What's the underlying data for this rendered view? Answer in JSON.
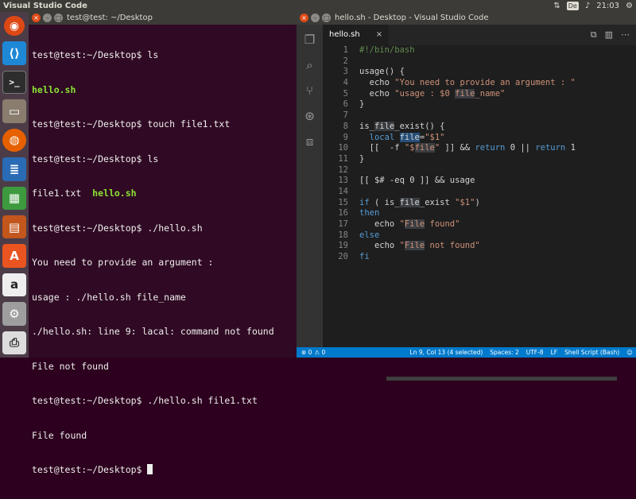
{
  "top_panel": {
    "app_title": "Visual Studio Code",
    "keyboard_indicator": "De",
    "clock": "21:03"
  },
  "launcher": {
    "items": [
      {
        "name": "Ubuntu dash",
        "glyph": "◉"
      },
      {
        "name": "Visual Studio Code",
        "glyph": "⟨⟩"
      },
      {
        "name": "Terminal",
        "glyph": ">_"
      },
      {
        "name": "Files",
        "glyph": "▭"
      },
      {
        "name": "Firefox",
        "glyph": "◍"
      },
      {
        "name": "LibreOffice Writer",
        "glyph": "≣"
      },
      {
        "name": "LibreOffice Calc",
        "glyph": "▦"
      },
      {
        "name": "LibreOffice Impress",
        "glyph": "▤"
      },
      {
        "name": "Ubuntu Software",
        "glyph": "A"
      },
      {
        "name": "Amazon",
        "glyph": "a"
      },
      {
        "name": "System Settings",
        "glyph": "⚙"
      },
      {
        "name": "Printers",
        "glyph": "⎙"
      }
    ]
  },
  "terminal": {
    "title": "test@test: ~/Desktop",
    "lines": [
      {
        "text": "test@test:~/Desktop$ ls",
        "style": "normal"
      },
      {
        "text": "hello.sh",
        "style": "green"
      },
      {
        "text": "test@test:~/Desktop$ touch file1.txt",
        "style": "normal"
      },
      {
        "text": "test@test:~/Desktop$ ls",
        "style": "normal"
      },
      {
        "text": "file1.txt  ",
        "extra": "hello.sh",
        "style": "mixed"
      },
      {
        "text": "test@test:~/Desktop$ ./hello.sh",
        "style": "normal"
      },
      {
        "text": "You need to provide an argument :",
        "style": "normal"
      },
      {
        "text": "usage : ./hello.sh file_name",
        "style": "normal"
      },
      {
        "text": "./hello.sh: line 9: lacal: command not found",
        "style": "normal"
      },
      {
        "text": "File not found",
        "style": "normal"
      },
      {
        "text": "test@test:~/Desktop$ ./hello.sh file1.txt",
        "style": "normal"
      },
      {
        "text": "File found",
        "style": "normal"
      },
      {
        "text": "test@test:~/Desktop$ ",
        "style": "prompt"
      }
    ]
  },
  "vscode": {
    "title": "hello.sh - Desktop - Visual Studio Code",
    "activity_icons": [
      "files-icon",
      "search-icon",
      "git-icon",
      "debug-icon",
      "extensions-icon"
    ],
    "tab": {
      "label": "hello.sh",
      "close": "×"
    },
    "tab_actions": [
      "⧉",
      "▥",
      "⋯"
    ],
    "code_lines": [
      [
        {
          "t": "#!/bin/bash",
          "c": "cmt"
        }
      ],
      [],
      [
        {
          "t": "usage() {",
          "c": ""
        }
      ],
      [
        {
          "t": "  echo ",
          "c": ""
        },
        {
          "t": "\"You need to provide an argument : \"",
          "c": "str"
        }
      ],
      [
        {
          "t": "  echo ",
          "c": ""
        },
        {
          "t": "\"usage : $0 ",
          "c": "str"
        },
        {
          "t": "file",
          "c": "str hl"
        },
        {
          "t": "_name\"",
          "c": "str"
        }
      ],
      [
        {
          "t": "}",
          "c": ""
        }
      ],
      [],
      [
        {
          "t": "is_",
          "c": ""
        },
        {
          "t": "file",
          "c": "hl"
        },
        {
          "t": "_exist() {",
          "c": ""
        }
      ],
      [
        {
          "t": "  ",
          "c": ""
        },
        {
          "t": "local",
          "c": "kw"
        },
        {
          "t": " ",
          "c": ""
        },
        {
          "t": "file",
          "c": "sel"
        },
        {
          "t": "=",
          "c": ""
        },
        {
          "t": "\"$1\"",
          "c": "str"
        }
      ],
      [
        {
          "t": "  [[  -f ",
          "c": ""
        },
        {
          "t": "\"$",
          "c": "str"
        },
        {
          "t": "file",
          "c": "str hl"
        },
        {
          "t": "\"",
          "c": "str"
        },
        {
          "t": " ]] && ",
          "c": ""
        },
        {
          "t": "return",
          "c": "kw"
        },
        {
          "t": " 0 || ",
          "c": ""
        },
        {
          "t": "return",
          "c": "kw"
        },
        {
          "t": " 1",
          "c": ""
        }
      ],
      [
        {
          "t": "}",
          "c": ""
        }
      ],
      [],
      [
        {
          "t": "[[ $# -eq 0 ]] && usage",
          "c": ""
        }
      ],
      [],
      [
        {
          "t": "if",
          "c": "kw"
        },
        {
          "t": " ( is_",
          "c": ""
        },
        {
          "t": "file",
          "c": "hl"
        },
        {
          "t": "_exist ",
          "c": ""
        },
        {
          "t": "\"$1\"",
          "c": "str"
        },
        {
          "t": ")",
          "c": ""
        }
      ],
      [
        {
          "t": "then",
          "c": "kw"
        }
      ],
      [
        {
          "t": "   echo ",
          "c": ""
        },
        {
          "t": "\"",
          "c": "str"
        },
        {
          "t": "File",
          "c": "str hl"
        },
        {
          "t": " found\"",
          "c": "str"
        }
      ],
      [
        {
          "t": "else",
          "c": "kw"
        }
      ],
      [
        {
          "t": "   echo ",
          "c": ""
        },
        {
          "t": "\"",
          "c": "str"
        },
        {
          "t": "File",
          "c": "str hl"
        },
        {
          "t": " not found\"",
          "c": "str"
        }
      ],
      [
        {
          "t": "fi",
          "c": "kw"
        }
      ]
    ],
    "status": {
      "errors": "⊗ 0",
      "warnings": "⚠ 0",
      "position": "Ln 9, Col 13 (4 selected)",
      "spaces": "Spaces: 2",
      "encoding": "UTF-8",
      "eol": "LF",
      "language": "Shell Script (Bash)",
      "feedback": "☺"
    }
  }
}
